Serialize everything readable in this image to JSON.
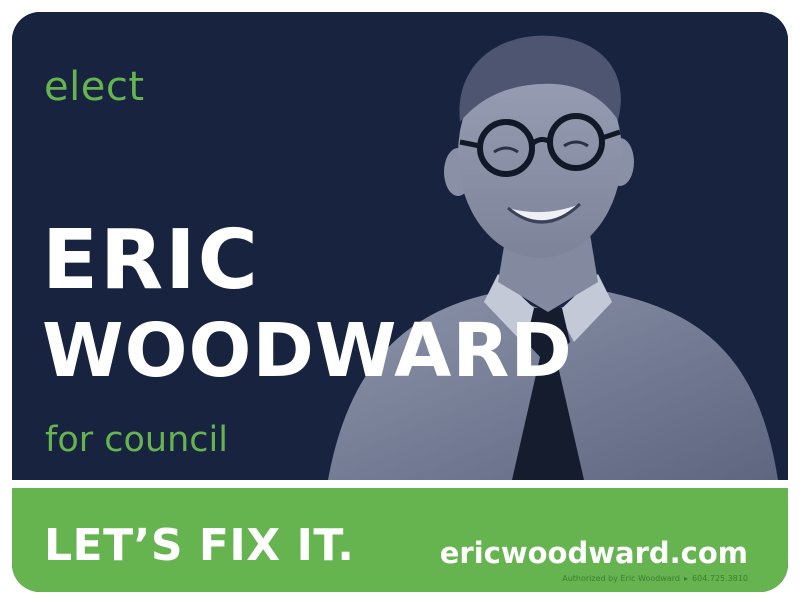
{
  "sign": {
    "elect": "elect",
    "first_name": "ERIC",
    "last_name": "WOODWARD",
    "for_council": "for council",
    "slogan": "LET’S FIX IT.",
    "website": "ericwoodward.com",
    "authorized_by": "Authorized by Eric Woodward",
    "separator": "▸",
    "phone": "604.725.3810"
  },
  "colors": {
    "navy": "#17233f",
    "green": "#65b44f",
    "white": "#ffffff"
  }
}
